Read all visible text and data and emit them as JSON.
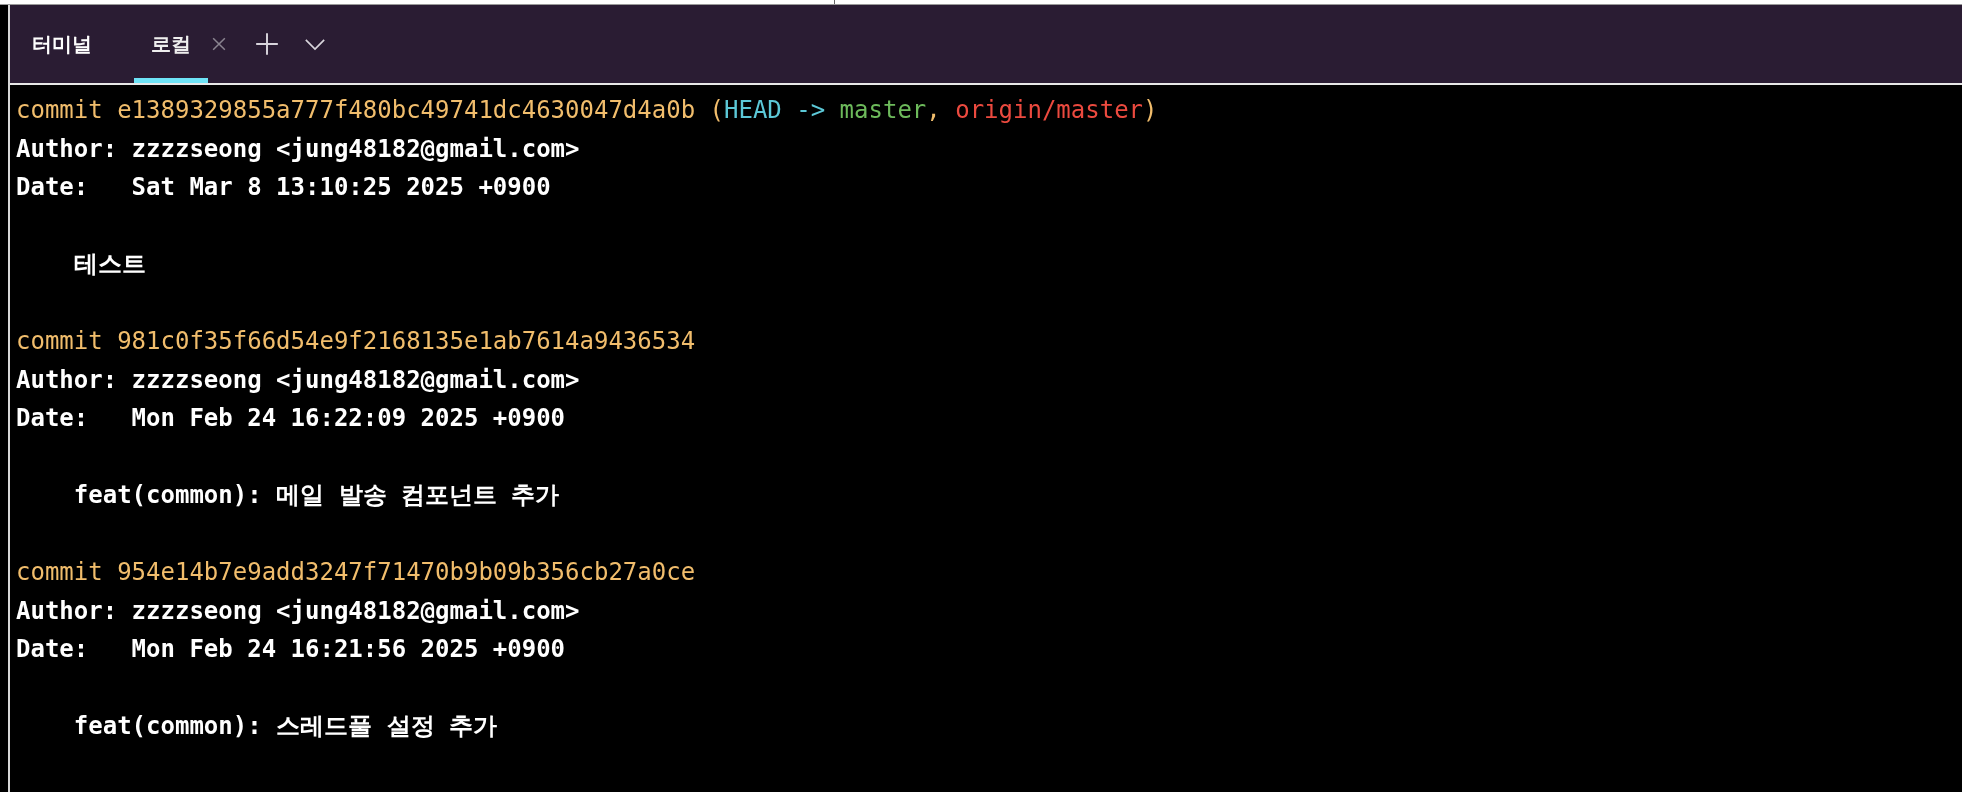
{
  "panel": {
    "title": "터미널"
  },
  "tabs": [
    {
      "label": "로컬",
      "selected": true,
      "closable": true
    }
  ],
  "lines": [
    {
      "kind": "commit",
      "segments": [
        {
          "kind": "hash",
          "text": "commit e1389329855a777f480bc49741dc4630047d4a0b ("
        },
        {
          "kind": "head",
          "text": "HEAD -> "
        },
        {
          "kind": "branch",
          "text": "master"
        },
        {
          "kind": "hash",
          "text": ", "
        },
        {
          "kind": "remote",
          "text": "origin/master"
        },
        {
          "kind": "hash",
          "text": ")"
        }
      ]
    },
    {
      "kind": "author",
      "text": "Author: zzzzseong <jung48182@gmail.com>"
    },
    {
      "kind": "date",
      "text": "Date:   Sat Mar 8 13:10:25 2025 +0900"
    },
    {
      "kind": "blank"
    },
    {
      "kind": "message",
      "text": "테스트"
    },
    {
      "kind": "blank"
    },
    {
      "kind": "commit",
      "segments": [
        {
          "kind": "hash",
          "text": "commit 981c0f35f66d54e9f2168135e1ab7614a9436534"
        }
      ]
    },
    {
      "kind": "author",
      "text": "Author: zzzzseong <jung48182@gmail.com>"
    },
    {
      "kind": "date",
      "text": "Date:   Mon Feb 24 16:22:09 2025 +0900"
    },
    {
      "kind": "blank"
    },
    {
      "kind": "message",
      "text": "feat(common): 메일 발송 컴포넌트 추가"
    },
    {
      "kind": "blank"
    },
    {
      "kind": "commit",
      "segments": [
        {
          "kind": "hash",
          "text": "commit 954e14b7e9add3247f71470b9b09b356cb27a0ce"
        }
      ]
    },
    {
      "kind": "author",
      "text": "Author: zzzzseong <jung48182@gmail.com>"
    },
    {
      "kind": "date",
      "text": "Date:   Mon Feb 24 16:21:56 2025 +0900"
    },
    {
      "kind": "blank"
    },
    {
      "kind": "message",
      "text": "feat(common): 스레드풀 설정 추가"
    }
  ]
}
